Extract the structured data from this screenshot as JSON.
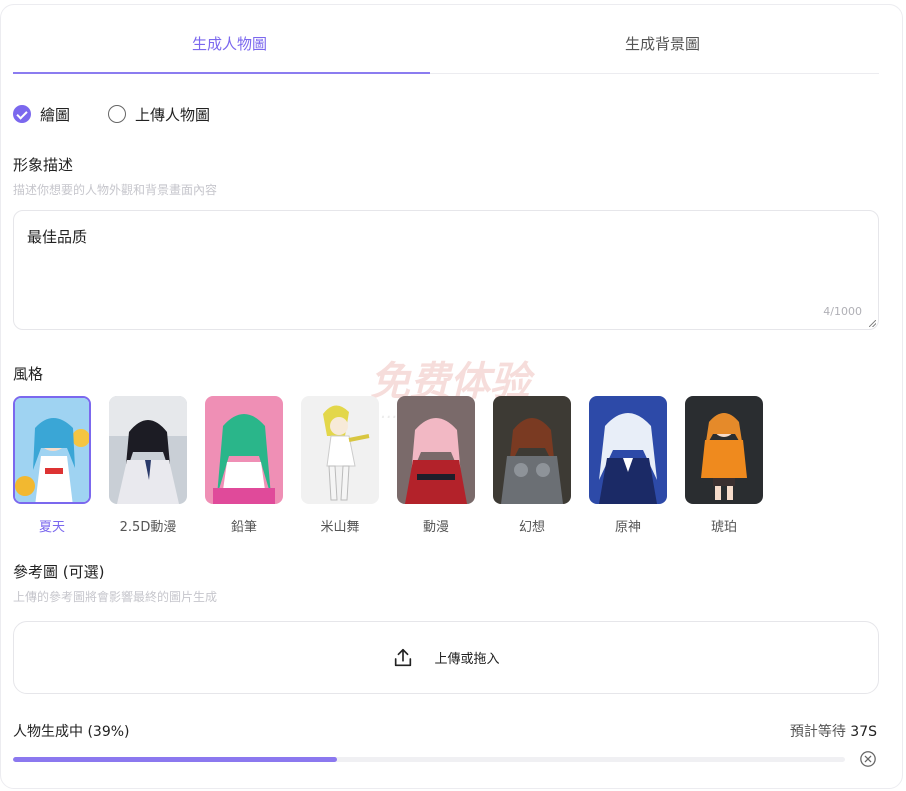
{
  "tabs": [
    {
      "label": "生成人物圖",
      "active": true
    },
    {
      "label": "生成背景圖",
      "active": false
    }
  ],
  "mode": {
    "options": [
      {
        "label": "繪圖",
        "checked": true
      },
      {
        "label": "上傳人物圖",
        "checked": false
      }
    ]
  },
  "description": {
    "title": "形象描述",
    "hint": "描述你想要的人物外觀和背景畫面內容",
    "value": "最佳品质",
    "counter": "4/1000"
  },
  "style": {
    "title": "風格",
    "items": [
      {
        "label": "夏天",
        "selected": true
      },
      {
        "label": "2.5D動漫",
        "selected": false
      },
      {
        "label": "鉛筆",
        "selected": false
      },
      {
        "label": "米山舞",
        "selected": false
      },
      {
        "label": "動漫",
        "selected": false
      },
      {
        "label": "幻想",
        "selected": false
      },
      {
        "label": "原神",
        "selected": false
      },
      {
        "label": "琥珀",
        "selected": false
      }
    ]
  },
  "reference": {
    "title": "參考圖 (可選)",
    "hint": "上傳的參考圖將會影響最終的圖片生成",
    "upload_label": "上傳或拖入"
  },
  "progress": {
    "label": "人物生成中 (39%)",
    "percent": 39,
    "eta_prefix": "預計等待",
    "eta_value": "37S"
  },
  "colors": {
    "accent": "#7b68ee",
    "progress": "#8b78ef"
  }
}
